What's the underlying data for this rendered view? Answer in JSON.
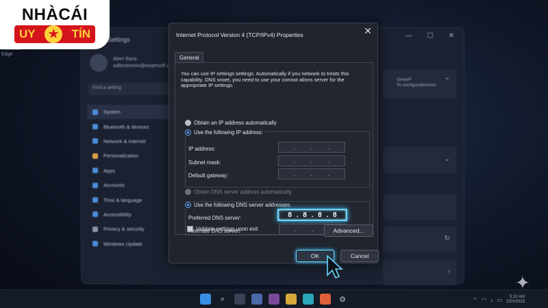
{
  "logo": {
    "line1": "NHÀCÁI",
    "line2_left": "UY",
    "line2_right": "TÍN",
    "star": "★"
  },
  "desktop": {
    "label": "Microsoft\nEdge"
  },
  "settings": {
    "title": "Settings",
    "user_name": "Aleer Bana",
    "user_email": "saltiestnoreo@wsqmsoft.cc",
    "search_placeholder": "Find a setting",
    "nav": [
      "System",
      "Bluetooth & devices",
      "Network & internet",
      "Personalization",
      "Apps",
      "Accounts",
      "Time & language",
      "Accessibility",
      "Privacy & security",
      "Windows Update"
    ],
    "right_cards": [
      "GestoP\nTo configurablesmin",
      "",
      "",
      ""
    ]
  },
  "dialog": {
    "title": "Internet Protocol Version 4 (TCP/IPv4) Properties",
    "close": "✕",
    "tab": "General",
    "intro": "You can use IP settings settings. Automatically if you network to treats this capability. DNS snoet, you need to use your corroot alinns server for the appropriate IP settings.",
    "ip_auto": "Obtain an IP address automatically",
    "ip_manual": "Use the following IP address:",
    "ip_address_label": "IP address:",
    "subnet_label": "Subnet mask:",
    "gateway_label": "Default gateway:",
    "dns_auto": "Obtain DNS server address automatically",
    "dns_manual": "Use the following DNS server addresses:",
    "preferred_label": "Preferred DNS server:",
    "alternate_label": "Alternate DNS server:",
    "preferred_value": [
      "8",
      ".",
      "8",
      ".",
      "8",
      ".",
      "8"
    ],
    "empty_dots": [
      ".",
      ".",
      "."
    ],
    "validate_label": "Validate settings upon exit",
    "advanced_label": "Advanced...",
    "ok_label": "OK",
    "cancel_label": "Cancel"
  },
  "taskbar": {
    "icons": [
      "windows-icon",
      "search-icon",
      "file-explorer-icon",
      "store-icon",
      "mail-icon",
      "folder-icon",
      "edge-icon",
      "photos-icon",
      "settings-icon"
    ],
    "time": "5:22 AM",
    "date": "2/20/2023"
  },
  "colors": {
    "accent_glow": "#6ad7ff",
    "logo_red": "#d4141b",
    "logo_yellow": "#ffd23c"
  }
}
